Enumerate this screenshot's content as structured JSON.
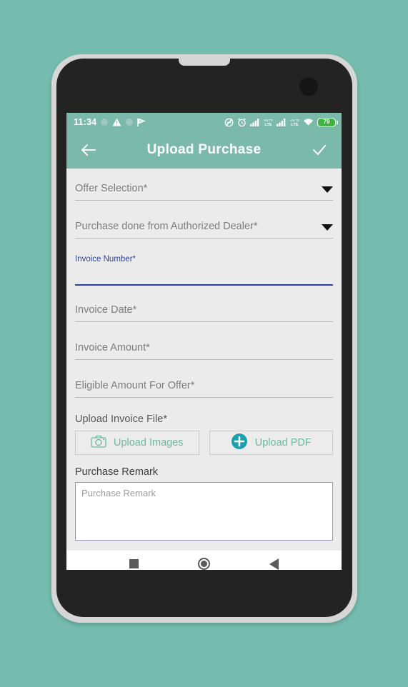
{
  "theme": {
    "background": "#75bcae",
    "appbar": "#7bb9ab",
    "form_background": "#ebebeb",
    "accent_blue": "#2f3fa0",
    "upload_green": "#6cb99f",
    "pdf_teal": "#1aa0ae"
  },
  "status_bar": {
    "time": "11:34",
    "battery_percent": "79",
    "icons": [
      "dot-icon",
      "warning-triangle-icon",
      "dot-icon",
      "play-flag-icon",
      "mute-icon",
      "alarm-clock-icon",
      "signal-bars-icon",
      "volte-icon",
      "signal-bars-2-icon",
      "volte-2-icon",
      "wifi-icon",
      "battery-icon"
    ]
  },
  "app_bar": {
    "back_icon": "back-arrow-icon",
    "title": "Upload Purchase",
    "confirm_icon": "checkmark-icon"
  },
  "form": {
    "fields": [
      {
        "label": "Offer Selection*",
        "type": "dropdown"
      },
      {
        "label": "Purchase done from Authorized Dealer*",
        "type": "dropdown"
      }
    ],
    "invoice_number": {
      "label": "Invoice Number*",
      "value": "",
      "placeholder": "",
      "focused": true
    },
    "text_fields": [
      {
        "label": "Invoice Date*"
      },
      {
        "label": "Invoice Amount*"
      },
      {
        "label": "Eligible Amount For Offer*"
      }
    ],
    "upload_section": {
      "label": "Upload Invoice File*",
      "buttons": [
        {
          "label": "Upload Images",
          "icon": "camera-icon"
        },
        {
          "label": "Upload PDF",
          "icon": "plus-circle-icon"
        }
      ]
    },
    "remark": {
      "label": "Purchase Remark",
      "placeholder": "Purchase Remark",
      "value": ""
    }
  },
  "nav_bar": {
    "buttons": [
      {
        "name": "recents",
        "icon": "square-icon"
      },
      {
        "name": "home",
        "icon": "circle-icon"
      },
      {
        "name": "back",
        "icon": "triangle-left-icon"
      }
    ]
  }
}
